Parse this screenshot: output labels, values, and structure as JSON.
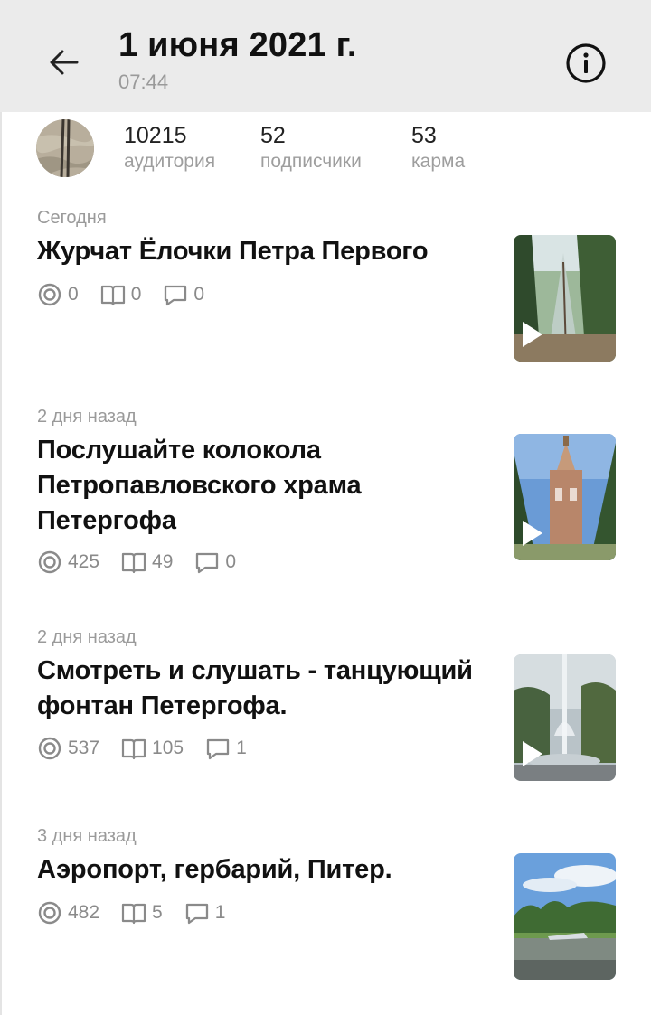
{
  "header": {
    "title": "1 июня 2021 г.",
    "subtitle": "07:44",
    "back_icon": "arrow-left-icon",
    "info_icon": "info-icon"
  },
  "profile": {
    "stats": [
      {
        "value": "10215",
        "label": "аудитория"
      },
      {
        "value": "52",
        "label": "подписчики"
      },
      {
        "value": "53",
        "label": "карма"
      }
    ]
  },
  "posts": [
    {
      "date": "Сегодня",
      "title": "Журчат Ёлочки Петра Первого",
      "views": "0",
      "reads": "0",
      "comments": "0"
    },
    {
      "date": "2 дня назад",
      "title": "Послушайте колокола Петропавловского храма Петергофа",
      "views": "425",
      "reads": "49",
      "comments": "0"
    },
    {
      "date": "2 дня назад",
      "title": "Смотреть и слушать - танцующий фонтан Петергофа.",
      "views": "537",
      "reads": "105",
      "comments": "1"
    },
    {
      "date": "3 дня назад",
      "title": "Аэропорт, гербарий, Питер.",
      "views": "482",
      "reads": "5",
      "comments": "1"
    }
  ]
}
